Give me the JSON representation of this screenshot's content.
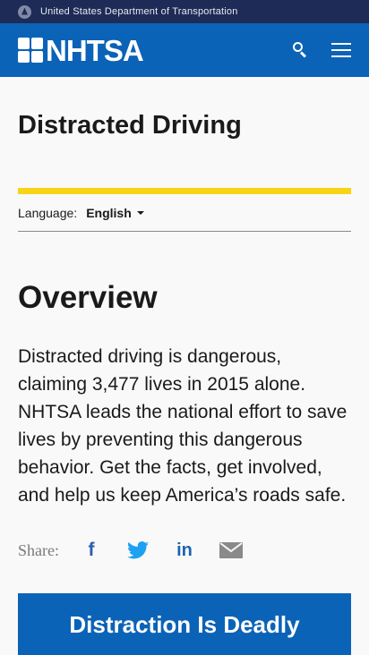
{
  "gov_bar": {
    "text": "United States Department of Transportation"
  },
  "header": {
    "logo_text": "NHTSA",
    "search_icon": "search-icon",
    "menu_icon": "hamburger-menu-icon",
    "brand_color": "#0b63b7"
  },
  "page": {
    "title": "Distracted Driving",
    "accent_color": "#f7d417"
  },
  "language": {
    "label": "Language:",
    "selected": "English"
  },
  "overview": {
    "heading": "Overview",
    "text": "Distracted driving is dangerous, claiming 3,477 lives in 2015 alone. NHTSA leads the national effort to save lives by preventing this dangerous behavior. Get the facts, get involved, and help us keep America’s roads safe."
  },
  "share": {
    "label": "Share:",
    "facebook_glyph": "f",
    "linkedin_glyph": "in",
    "icons": [
      "facebook-icon",
      "twitter-icon",
      "linkedin-icon",
      "email-icon"
    ]
  },
  "cta": {
    "label": "Distraction Is Deadly"
  }
}
